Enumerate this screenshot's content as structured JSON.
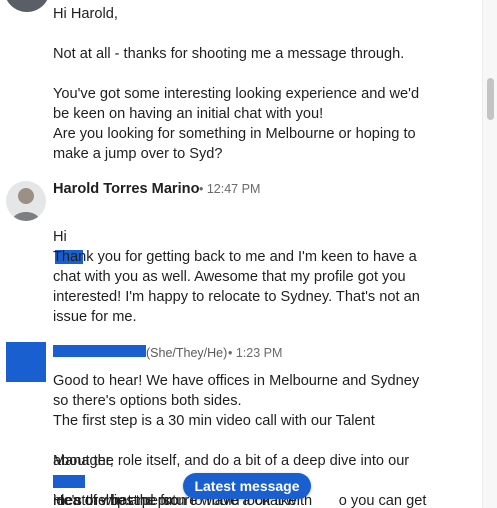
{
  "thread": {
    "message_1": {
      "text": "Hi Harold,\n\nNot at all - thanks for shooting me a message through.\n\nYou've got some interesting looking experience and we'd be keen on having an initial chat with you!\nAre you looking for something in Melbourne or hoping to make a jump over to Syd?"
    },
    "harold": {
      "name": "Harold Torres Marino",
      "time": "• 12:47 PM",
      "greeting": "Hi",
      "text": "Thank you for getting back to me and I'm keen to have a chat with you as well. Awesome that my profile got you interested! I'm happy to relocate to Sydney. That's not an issue for me."
    },
    "recruiter": {
      "pronouns": "(She/They/He)",
      "time": "• 1:23 PM",
      "text_1": "Good to hear! We have offices in Melbourne and Sydney so there's options both sides.\nThe first step is a 30 min video call with our Talent",
      "text_2a": "Manager,",
      "text_2b": "He's the best person to have a chat with",
      "text_3": "about the role itself, and do a bit of a deep dive into our",
      "text_4a": "mentorship and pro",
      "text_4b": "o you can get an",
      "text_5": "idea of what the future would look like."
    }
  },
  "latest_message_button": "Latest message",
  "colors": {
    "accent": "#1a5fd0",
    "meta": "#6a6a6a"
  }
}
